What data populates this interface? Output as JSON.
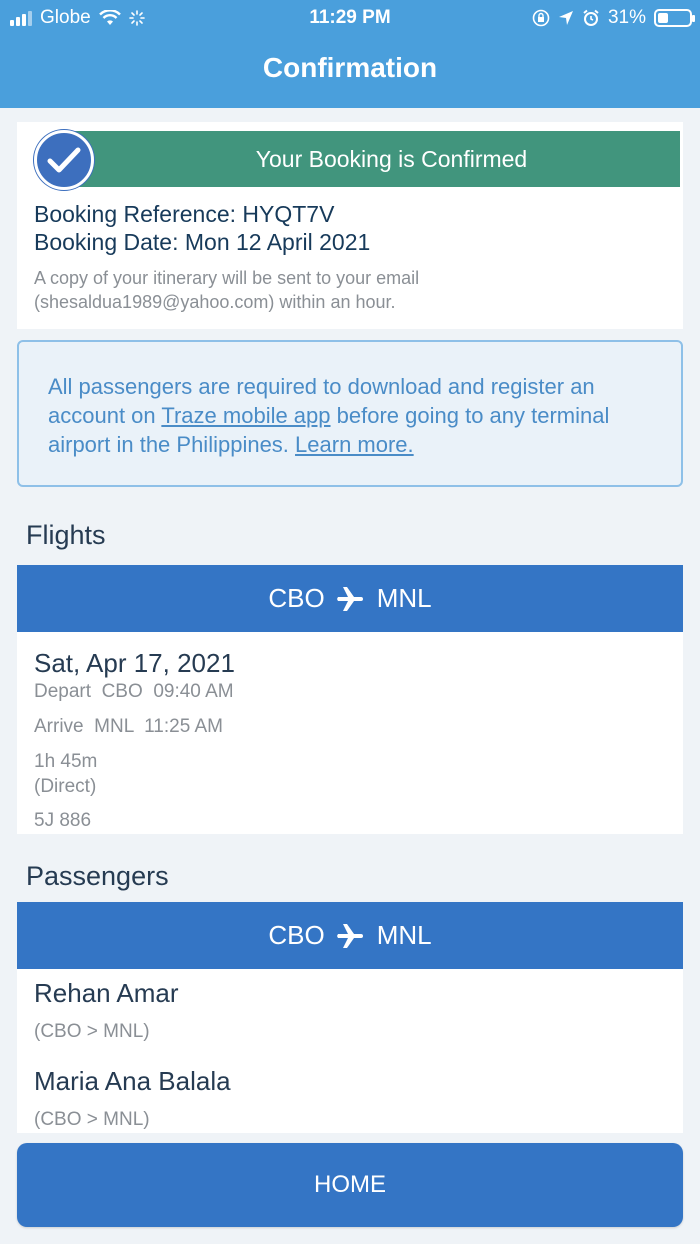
{
  "status_bar": {
    "carrier": "Globe",
    "time": "11:29 PM",
    "battery": "31%"
  },
  "header": {
    "title": "Confirmation"
  },
  "confirmation": {
    "banner": "Your Booking is Confirmed",
    "booking_reference": "Booking Reference: HYQT7V",
    "booking_date": "Booking Date: Mon 12 April 2021",
    "copy_note_line1": "A copy of your itinerary will be sent to your email",
    "copy_note_line2": "(shesaldua1989@yahoo.com) within an hour."
  },
  "notice": {
    "text_before": "All passengers are required to download and register an account on ",
    "app_link": "Traze mobile app",
    "text_middle": " before going to any terminal airport in the Philippines. ",
    "learn_more": "Learn more."
  },
  "flights": {
    "section_title": "Flights",
    "origin": "CBO",
    "destination": "MNL",
    "date": "Sat, Apr 17, 2021",
    "depart": "Depart  CBO  09:40 AM",
    "arrive": "Arrive  MNL  11:25 AM",
    "duration": "1h 45m",
    "stops": "(Direct)",
    "flight_number": "5J 886"
  },
  "passengers": {
    "section_title": "Passengers",
    "origin": "CBO",
    "destination": "MNL",
    "list": [
      {
        "name": "Rehan Amar",
        "route": "(CBO > MNL)"
      },
      {
        "name": "Maria Ana Balala",
        "route": "(CBO > MNL)"
      }
    ]
  },
  "footer": {
    "home_label": "HOME"
  },
  "colors": {
    "header": "#4a9fdc",
    "confirm_green": "#41957d",
    "primary_blue": "#3475c5",
    "notice_text": "#4a8cc7"
  }
}
